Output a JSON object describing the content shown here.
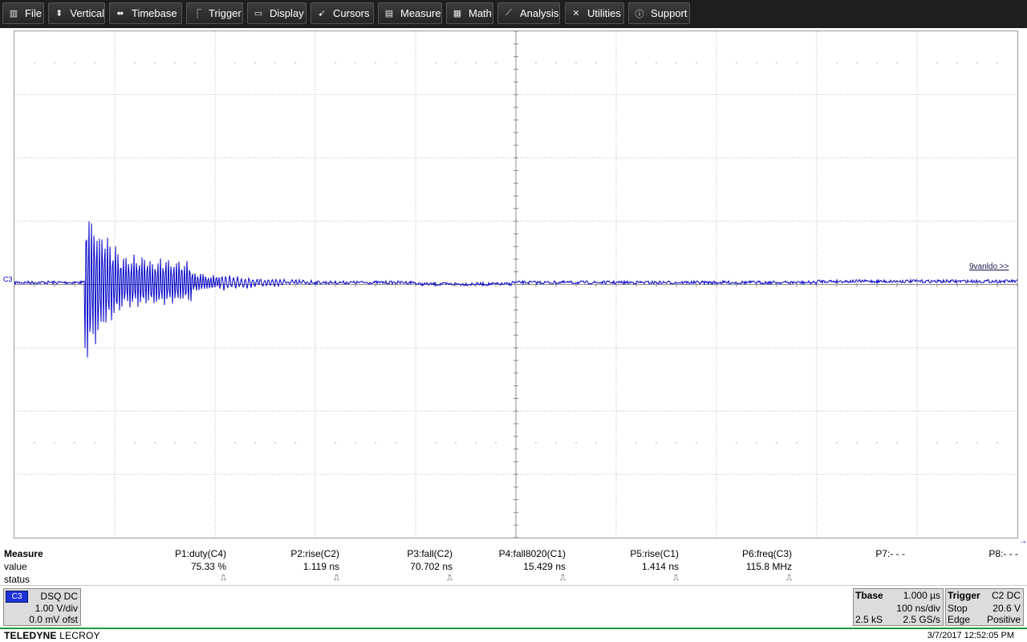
{
  "menu": {
    "items": [
      {
        "label": "File",
        "icon": "clipboard-icon",
        "glyph": "▥"
      },
      {
        "label": "Vertical",
        "icon": "vertical-arrows-icon",
        "glyph": "⬍"
      },
      {
        "label": "Timebase",
        "icon": "horizontal-arrows-icon",
        "glyph": "⬌"
      },
      {
        "label": "Trigger",
        "icon": "trigger-edge-icon",
        "glyph": "⎾"
      },
      {
        "label": "Display",
        "icon": "display-icon",
        "glyph": "▭"
      },
      {
        "label": "Cursors",
        "icon": "cursor-icon",
        "glyph": "➹"
      },
      {
        "label": "Measure",
        "icon": "measure-icon",
        "glyph": "▤"
      },
      {
        "label": "Math",
        "icon": "calculator-icon",
        "glyph": "▦"
      },
      {
        "label": "Analysis",
        "icon": "analysis-chart-icon",
        "glyph": "⟋"
      },
      {
        "label": "Utilities",
        "icon": "tools-icon",
        "glyph": "✕"
      },
      {
        "label": "Support",
        "icon": "info-icon",
        "glyph": "ⓘ"
      }
    ]
  },
  "display": {
    "channel_tag": "C3",
    "trace_marker": "9vanldo >>",
    "trace_color": "#0000c8"
  },
  "measure": {
    "title": "Measure",
    "row_labels": [
      "value",
      "status"
    ],
    "params": [
      {
        "name": "P1:duty(C4)",
        "value": "75.33 %",
        "status": "⎍"
      },
      {
        "name": "P2:rise(C2)",
        "value": "1.119 ns",
        "status": "⎍"
      },
      {
        "name": "P3:fall(C2)",
        "value": "70.702 ns",
        "status": "⎍"
      },
      {
        "name": "P4:fall8020(C1)",
        "value": "15.429 ns",
        "status": "⎍"
      },
      {
        "name": "P5:rise(C1)",
        "value": "1.414 ns",
        "status": "⎍"
      },
      {
        "name": "P6:freq(C3)",
        "value": "115.8 MHz",
        "status": "⎍"
      },
      {
        "name": "P7:- - -",
        "value": "",
        "status": ""
      },
      {
        "name": "P8:- - -",
        "value": "",
        "status": ""
      }
    ]
  },
  "channel_panel": {
    "badge": "C3",
    "coupling": "DSQ DC",
    "scale": "1.00 V/div",
    "offset": "0.0 mV ofst",
    "color": "#1f34d8"
  },
  "timebase_panel": {
    "title": "Tbase",
    "delay": "1.000 µs",
    "per_div": "100 ns/div",
    "samples": "2.5 kS",
    "rate": "2.5 GS/s"
  },
  "trigger_panel": {
    "title": "Trigger",
    "source": "C2 DC",
    "mode": "Stop",
    "level": "20.6 V",
    "type": "Edge",
    "slope": "Positive"
  },
  "footer": {
    "brand_bold": "TELEDYNE",
    "brand_light": " LECROY",
    "timestamp": "3/7/2017 12:52:05 PM",
    "accent": "#1e9a3a"
  }
}
